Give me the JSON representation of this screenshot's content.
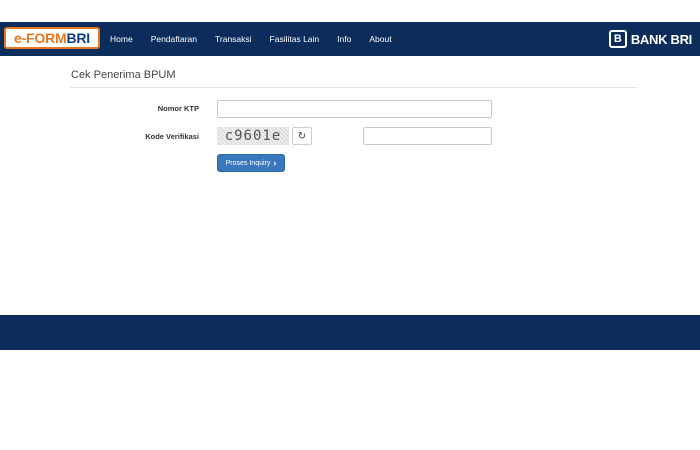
{
  "header": {
    "logo_part1": "e-FORM",
    "logo_part2": "BRI",
    "nav": [
      "Home",
      "Pendaftaran",
      "Transaksi",
      "Fasilitas Lain",
      "Info",
      "About"
    ],
    "bank_mark": "B",
    "bank_name": "BANK BRI"
  },
  "page": {
    "title": "Cek Penerima BPUM"
  },
  "form": {
    "ktp_label": "Nomor KTP",
    "ktp_value": "",
    "kode_label": "Kode Verifikasi",
    "captcha_text": "c9601e",
    "refresh_icon": "↻",
    "kode_value": "",
    "submit_label": "Proses Inquiry",
    "submit_icon": "›"
  },
  "colors": {
    "navbar": "#0c2d5c",
    "logo_orange": "#e8781f",
    "logo_blue": "#0c3e88",
    "button": "#3a78bd"
  }
}
